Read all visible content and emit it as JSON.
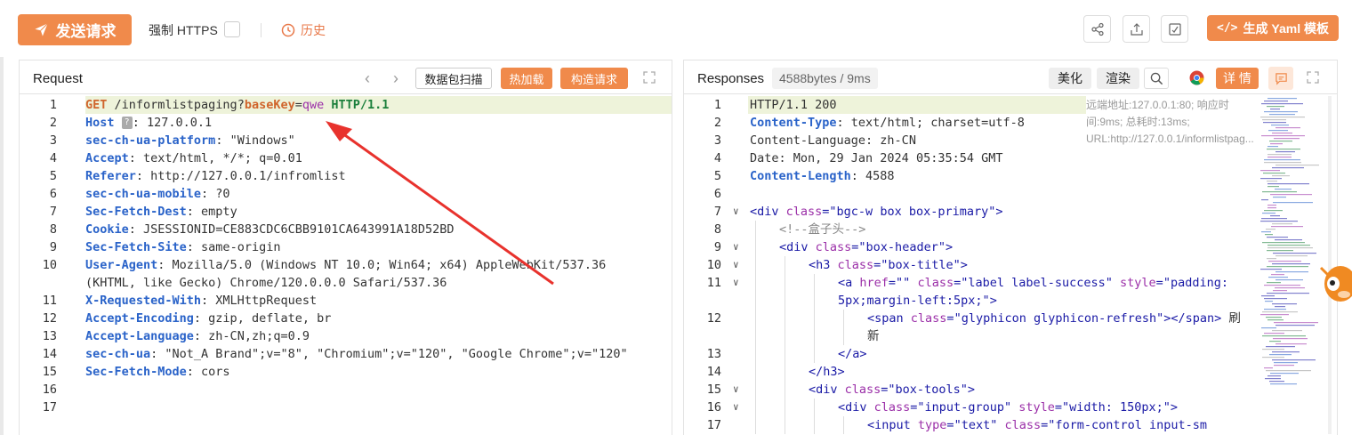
{
  "toolbar": {
    "send_label": "发送请求",
    "https_label": "强制 HTTPS",
    "history_label": "历史",
    "yaml_label": "生成 Yaml 模板"
  },
  "request": {
    "title": "Request",
    "scan_label": "数据包扫描",
    "hotload_label": "热加载",
    "construct_label": "构造请求",
    "lines": [
      {
        "n": "1",
        "method": "GET",
        "path": " /informlistpaging?",
        "pkey": "baseKey",
        "eq": "=",
        "pval": "qwe",
        "proto": " HTTP/1.1"
      },
      {
        "n": "2",
        "key": "Host",
        "badge": "?",
        "val": ": 127.0.0.1"
      },
      {
        "n": "3",
        "key": "sec-ch-ua-platform",
        "val": ": \"Windows\""
      },
      {
        "n": "4",
        "key": "Accept",
        "val": ": text/html, */*; q=0.01"
      },
      {
        "n": "5",
        "key": "Referer",
        "val": ": http://127.0.0.1/infromlist"
      },
      {
        "n": "6",
        "key": "sec-ch-ua-mobile",
        "val": ": ?0"
      },
      {
        "n": "7",
        "key": "Sec-Fetch-Dest",
        "val": ": empty"
      },
      {
        "n": "8",
        "key": "Cookie",
        "val": ": JSESSIONID=CE883CDC6CBB9101CA643991A18D52BD"
      },
      {
        "n": "9",
        "key": "Sec-Fetch-Site",
        "val": ": same-origin"
      },
      {
        "n": "10",
        "key": "User-Agent",
        "val": ": Mozilla/5.0 (Windows NT 10.0; Win64; x64) AppleWebKit/537.36"
      },
      {
        "n": "",
        "cont": "(KHTML, like Gecko) Chrome/120.0.0.0 Safari/537.36"
      },
      {
        "n": "11",
        "key": "X-Requested-With",
        "val": ": XMLHttpRequest"
      },
      {
        "n": "12",
        "key": "Accept-Encoding",
        "val": ": gzip, deflate, br"
      },
      {
        "n": "13",
        "key": "Accept-Language",
        "val": ": zh-CN,zh;q=0.9"
      },
      {
        "n": "14",
        "key": "sec-ch-ua",
        "val": ": \"Not_A Brand\";v=\"8\", \"Chromium\";v=\"120\", \"Google Chrome\";v=\"120\""
      },
      {
        "n": "15",
        "key": "Sec-Fetch-Mode",
        "val": ": cors"
      },
      {
        "n": "16"
      },
      {
        "n": "17"
      }
    ]
  },
  "response": {
    "title": "Responses",
    "size_badge": "4588bytes / 9ms",
    "beautify_label": "美化",
    "render_label": "渲染",
    "detail_label": "详 情",
    "info": "远端地址:127.0.0.1:80; 响应时间:9ms; 总耗时:13ms; URL:http://127.0.0.1/informlistpag...",
    "status_line": "HTTP/1.1 200",
    "headers": [
      {
        "n": "2",
        "key": "Content-Type",
        "val": ": text/html; charset=utf-8",
        "bold": true
      },
      {
        "n": "3",
        "key": "Content-Language",
        "val": ": zh-CN",
        "bold": false
      },
      {
        "n": "4",
        "key": "Date",
        "val": ": Mon, 29 Jan 2024 05:35:54 GMT",
        "bold": false
      },
      {
        "n": "5",
        "key": "Content-Length",
        "val": ": 4588",
        "bold": true
      }
    ],
    "body_line_numbers": [
      "6",
      "7",
      "8",
      "9",
      "10",
      "11",
      "",
      "12",
      "",
      "13",
      "14",
      "15",
      "16",
      "17"
    ],
    "comment": "<!--盒子头-->",
    "cn_text_1": "刷",
    "cn_text_2": "新"
  },
  "colors": {
    "accent": "#f08a4b",
    "key_blue": "#2a63c9",
    "param_orange": "#d0652c",
    "highlight_line": "#eef3da"
  },
  "icons": [
    "paper-plane-icon",
    "clock-icon",
    "share-icon",
    "upload-icon",
    "edit-icon",
    "code-icon",
    "expand-icon",
    "search-icon",
    "chrome-icon",
    "comment-icon"
  ]
}
